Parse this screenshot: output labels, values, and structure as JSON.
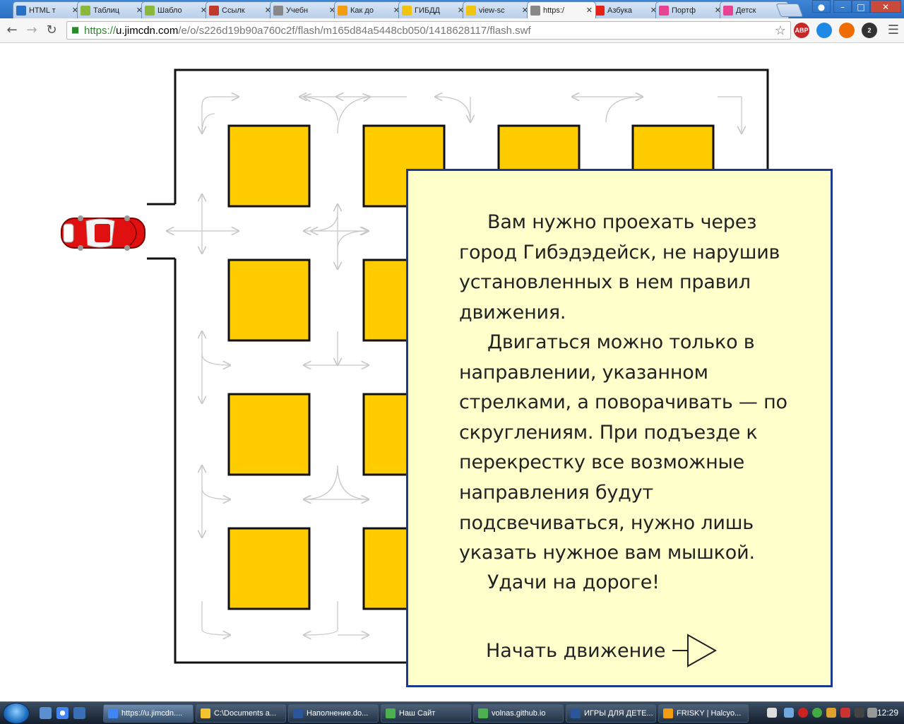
{
  "browser": {
    "tabs": [
      {
        "label": "HTML т",
        "icon": "sitemap-icon",
        "color": "#2a6fc4"
      },
      {
        "label": "Таблиц",
        "icon": "sprout-icon",
        "color": "#8ab83a"
      },
      {
        "label": "Шабло",
        "icon": "sprout-icon",
        "color": "#8ab83a"
      },
      {
        "label": "Ссылк",
        "icon": "letter-a-icon",
        "color": "#c0392b"
      },
      {
        "label": "Учебн",
        "icon": "page-icon",
        "color": "#888888"
      },
      {
        "label": "Как до",
        "icon": "circle-icon",
        "color": "#f39c12"
      },
      {
        "label": "ГИБДД",
        "icon": "sun-icon",
        "color": "#f1c40f"
      },
      {
        "label": "view-sc",
        "icon": "sun-icon",
        "color": "#f1c40f"
      },
      {
        "label": "https:/",
        "icon": "page-icon",
        "color": "#888888",
        "active": true
      },
      {
        "label": "Азбука",
        "icon": "youtube-icon",
        "color": "#e62117"
      },
      {
        "label": "Портф",
        "icon": "flower-icon",
        "color": "#e84393"
      },
      {
        "label": "Детск",
        "icon": "flower-icon",
        "color": "#e84393"
      }
    ],
    "url": {
      "scheme": "https://",
      "host": "u.jimcdn.com",
      "path": "/e/o/s226d19b90a760c2f/flash/m165d84a5448cb050/1418628117/flash.swf"
    },
    "extensions": [
      {
        "label": "ABP",
        "color": "#c62828"
      },
      {
        "label": "",
        "color": "#1e88e5"
      },
      {
        "label": "",
        "color": "#ef6c00"
      },
      {
        "label": "2",
        "color": "#333333"
      }
    ]
  },
  "game": {
    "intro_paragraphs": [
      "Вам нужно проехать через город Гибэдэдейск, не нарушив установленных в нем правил движения.",
      "Двигаться можно только в направлении, указанном стрелками, а поворачивать — по скруглениям. При подъезде к перекрестку все возможные направления будут подсвечиваться, нужно лишь указать нужное вам мышкой.",
      "Удачи на дороге!"
    ],
    "start_label": "Начать движение",
    "block_color": "#ffcc00",
    "dialog_bg": "#ffffcc",
    "dialog_border": "#1a3a8f"
  },
  "taskbar": {
    "items": [
      {
        "label": "https://u.jimcdn....",
        "color": "#4285f4",
        "active": true
      },
      {
        "label": "C:\\Documents a...",
        "color": "#f4c430"
      },
      {
        "label": "Наполнение.do...",
        "color": "#2b579a"
      },
      {
        "label": "Наш Сайт",
        "color": "#4caf50"
      },
      {
        "label": "volnas.github.io",
        "color": "#4caf50"
      },
      {
        "label": "ИГРЫ ДЛЯ ДЕТЕ...",
        "color": "#2b579a"
      },
      {
        "label": "FRISKY | Halcyo...",
        "color": "#f39c12"
      }
    ],
    "clock": "12:29"
  }
}
